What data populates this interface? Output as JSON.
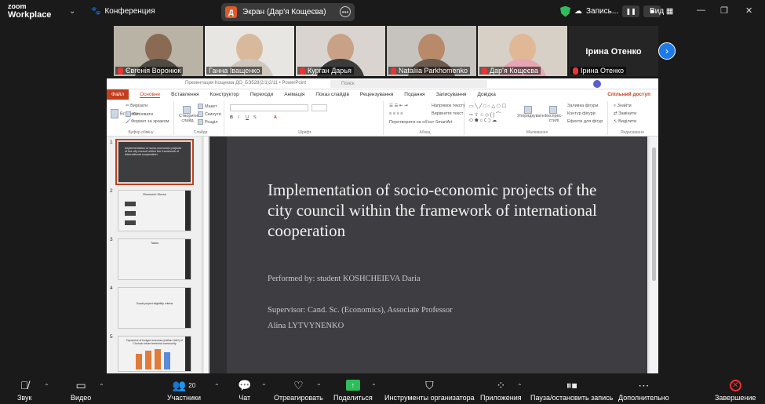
{
  "app": {
    "logo_line1": "zoom",
    "logo_line2": "Workplace",
    "meeting_label": "Конференция"
  },
  "share_banner": {
    "initial": "Д",
    "text": "Экран (Дар'я Кощеєва)"
  },
  "recording": {
    "label": "Запись..."
  },
  "view_label": "Вид",
  "participants": [
    {
      "name": "Євгенія Воронюк",
      "muted": true
    },
    {
      "name": "Ганна Іващенко",
      "muted": false
    },
    {
      "name": "Курган Дарья",
      "muted": true
    },
    {
      "name": "Nataliia Parkhomenko",
      "muted": true
    },
    {
      "name": "Дар'я Кощеєва",
      "muted": true,
      "active": true
    },
    {
      "name": "Ірина Отенко",
      "muted": true,
      "big_name": "Ірина Отенко"
    }
  ],
  "powerpoint": {
    "file_name": "Презентация Кощеєва ДО_БЭ528(2/1)2/11 • PowerPoint",
    "search_placeholder": "Поиск",
    "tabs": [
      "Файл",
      "Основне",
      "Вставлення",
      "Конструктор",
      "Переходи",
      "Анімація",
      "Показ слайдів",
      "Рецензування",
      "Подання",
      "Записування",
      "Довідка"
    ],
    "share_label": "Спільний доступ",
    "groups": {
      "clipboard": {
        "label": "Буфер обміну",
        "paste": "Вставити",
        "cut": "Вирізати",
        "copy": "Копіювати",
        "format": "Формат за зразком"
      },
      "slides": {
        "label": "Слайди",
        "new": "Створити слайд",
        "layout": "Макет",
        "reset": "Скинути",
        "section": "Розділ"
      },
      "font": {
        "label": "Шрифт"
      },
      "paragraph": {
        "label": "Абзац",
        "direction": "Напрямок тексту",
        "align": "Вирівняти текст",
        "smartart": "Перетворити на об'єкт SmartArt"
      },
      "drawing": {
        "label": "Малювання",
        "arrange": "Упорядкувати",
        "styles": "Експрес-стилі",
        "fill": "Заливка фігури",
        "outline": "Контур фігури",
        "effects": "Ефекти для фігур"
      },
      "editing": {
        "label": "Редагування",
        "find": "Знайти",
        "replace": "Замінити",
        "select": "Виділити"
      }
    },
    "thumbnails": [
      {
        "num": "1",
        "text": "Implementation of socio-economic projects of the city council within the framework of international cooperation"
      },
      {
        "num": "2",
        "text": "Research Stress"
      },
      {
        "num": "3",
        "text": "Tasks"
      },
      {
        "num": "4",
        "text": "Social project eligibility criteria"
      },
      {
        "num": "5",
        "text": "Dynamics of budget revenues (million UAH) of Chuhuiv urban territorial community"
      }
    ],
    "slide": {
      "title": "Implementation of socio-economic projects of the city council within the framework of international cooperation",
      "performed_by": "Performed by: student KOSHCHEIEVA Daria",
      "supervisor": "Supervisor: Cand. Sc. (Economics), Associate Professor",
      "supervisor_name": "Alina LYTVYNENKO"
    }
  },
  "toolbar": {
    "audio": "Звук",
    "video": "Видео",
    "participants": "Участники",
    "participants_count": "20",
    "chat": "Чат",
    "react": "Отреагировать",
    "share": "Поделиться",
    "host_tools": "Инструменты организатора",
    "apps": "Приложения",
    "pause_record": "Пауза/остановить запись",
    "more": "Дополнительно",
    "end": "Завершение"
  },
  "colors": {
    "accent_green": "#2ed573",
    "pp_red": "#c43e1c",
    "zoom_blue": "#1e7ae8",
    "end_red": "#e33333"
  }
}
